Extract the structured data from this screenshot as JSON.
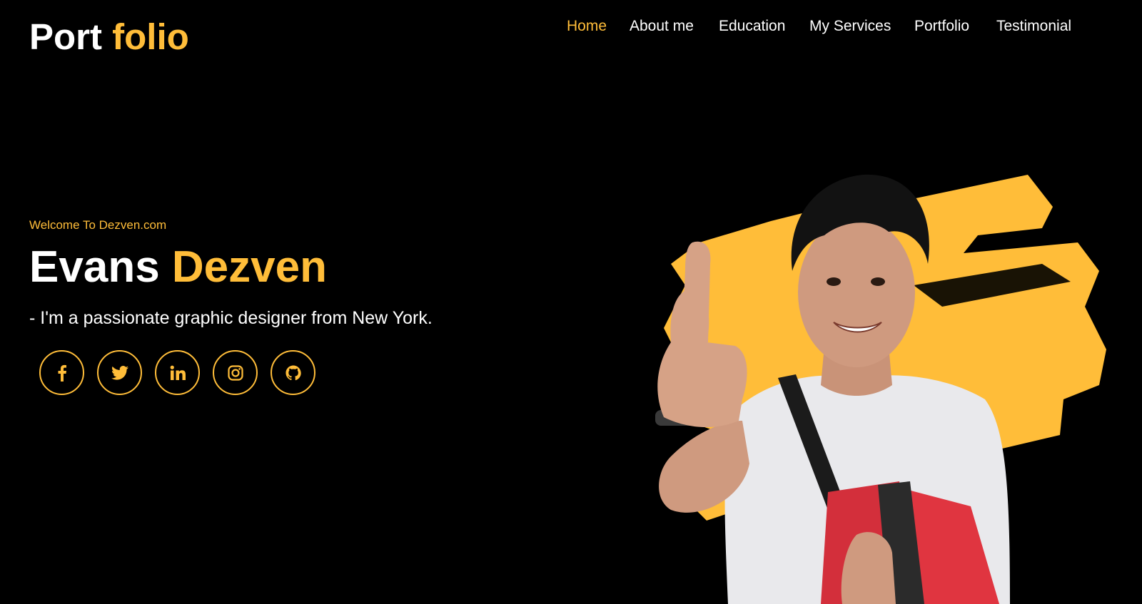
{
  "brand": {
    "logo_part1": "Port",
    "logo_part2": "folio",
    "accent_color": "#ffbd39"
  },
  "nav": {
    "items": [
      {
        "label": "Home",
        "active": true
      },
      {
        "label": "About me",
        "active": false
      },
      {
        "label": "Education",
        "active": false
      },
      {
        "label": "My Services",
        "active": false
      },
      {
        "label": "Portfolio",
        "active": false
      },
      {
        "label": "Testimonial",
        "active": false
      }
    ]
  },
  "hero": {
    "welcome": "Welcome To Dezven.com",
    "name_first": "Evans",
    "name_last": "Dezven",
    "tagline": "- I'm a passionate graphic designer from New York."
  },
  "social": {
    "icons": [
      "facebook-icon",
      "twitter-icon",
      "linkedin-icon",
      "instagram-icon",
      "github-icon"
    ]
  },
  "image": {
    "description_icon": "hero-photo",
    "background_splash_color": "#ffbd39"
  }
}
